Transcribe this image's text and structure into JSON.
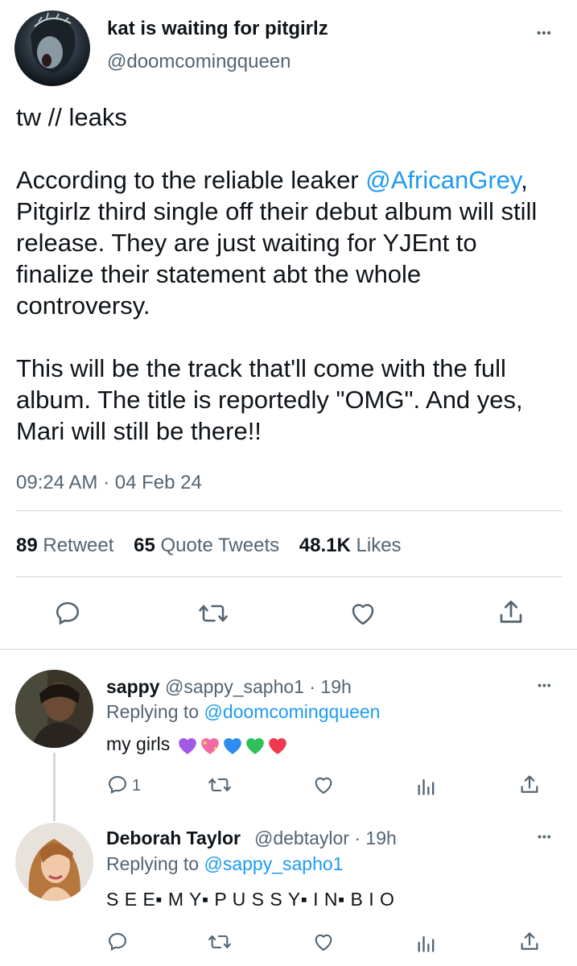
{
  "main_tweet": {
    "display_name": "kat is waiting for pitgirlz",
    "handle": "@doomcomingqueen",
    "line_tw": "tw // leaks",
    "para1_pre": "According to the reliable leaker ",
    "para1_mention": "@AfricanGrey",
    "para1_post": ", Pitgirlz third single off their debut album will still release. They are just waiting for YJEnt to finalize their statement abt the whole controversy.",
    "para2": "This will be the track that'll come with the full album. The title is reportedly \"OMG\". And yes, Mari will still be there!!",
    "timestamp": "09:24 AM · 04 Feb 24",
    "retweet_count": "89",
    "retweet_label": "Retweet",
    "quote_count": "65",
    "quote_label": "Quote Tweets",
    "like_count": "48.1K",
    "like_label": "Likes",
    "more_label": "•••"
  },
  "replies": [
    {
      "display_name": "sappy",
      "handle": "@sappy_sapho1 · 19h",
      "replying_prefix": "Replying to ",
      "replying_handle": "@doomcomingqueen",
      "text": "my girls",
      "emojis": [
        "purple-heart",
        "sparkling-heart",
        "blue-heart",
        "green-heart",
        "red-heart"
      ],
      "reply_count": "1",
      "more_label": "•••"
    },
    {
      "display_name": "Deborah Taylor",
      "handle": "@debtaylor · 19h",
      "replying_prefix": "Replying to ",
      "replying_handle": "@sappy_sapho1",
      "text": "S E E▪ M Y▪ P U S S Y▪ I N▪ B I O",
      "more_label": "•••"
    }
  ],
  "colors": {
    "link": "#1d9bf0",
    "text": "#0f1419",
    "secondary": "#536471",
    "divider": "#cfd9de"
  }
}
